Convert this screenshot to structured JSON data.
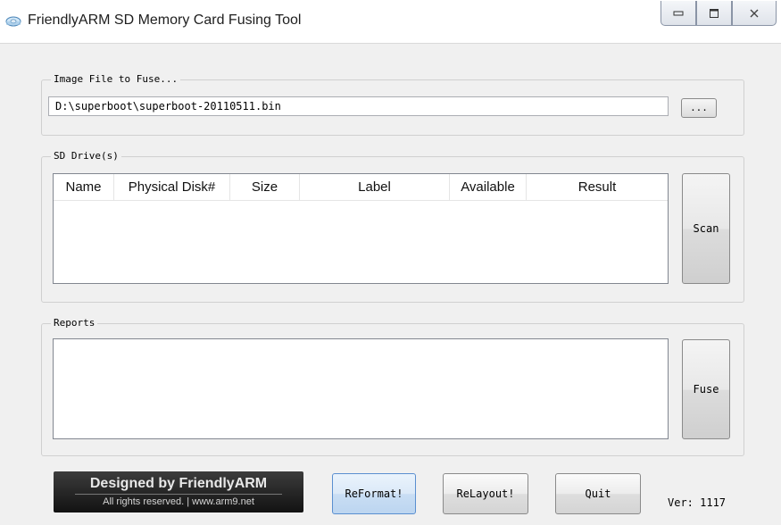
{
  "window": {
    "title": "FriendlyARM SD Memory Card Fusing Tool"
  },
  "image_group": {
    "label": "Image File to Fuse...",
    "path_value": "D:\\superboot\\superboot-20110511.bin",
    "browse_label": "..."
  },
  "drives_group": {
    "label": "SD Drive(s)",
    "columns": [
      "Name",
      "Physical Disk#",
      "Size",
      "Label",
      "Available",
      "Result"
    ],
    "scan_label": "Scan"
  },
  "reports_group": {
    "label": "Reports",
    "fuse_label": "Fuse"
  },
  "footer": {
    "logo_line1": "Designed by FriendlyARM",
    "logo_line2": "All rights reserved. | www.arm9.net",
    "reformat_label": "ReFormat!",
    "relayout_label": "ReLayout!",
    "quit_label": "Quit",
    "version": "Ver: 1117"
  }
}
